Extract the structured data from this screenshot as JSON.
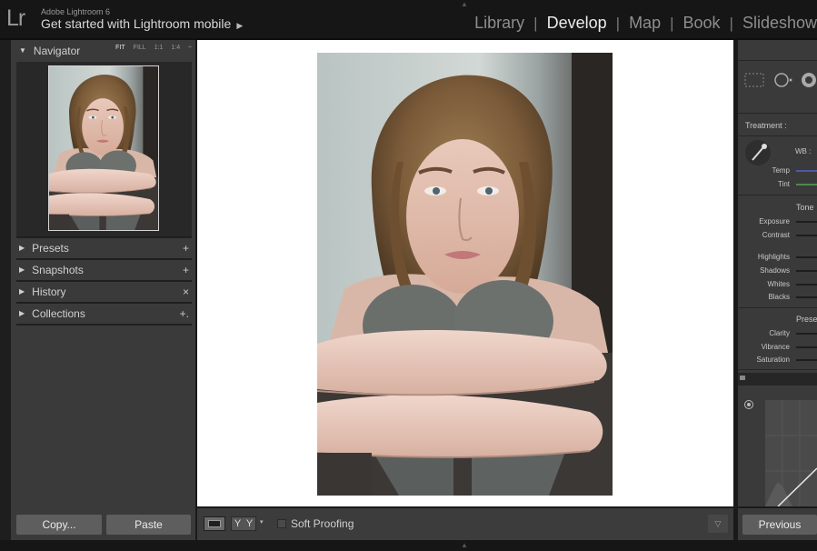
{
  "app": {
    "logo": "Lr",
    "version": "Adobe Lightroom 6",
    "mobile_prompt": "Get started with Lightroom mobile",
    "mobile_arrow": "▶"
  },
  "modules": [
    "Library",
    "Develop",
    "Map",
    "Book",
    "Slideshow"
  ],
  "active_module": "Develop",
  "navigator": {
    "title": "Navigator",
    "zoom": [
      "FIT",
      "FILL",
      "1:1",
      "1:4",
      "÷"
    ],
    "active_zoom": "FIT"
  },
  "left_panels": [
    {
      "label": "Presets",
      "action": "+"
    },
    {
      "label": "Snapshots",
      "action": "+"
    },
    {
      "label": "History",
      "action": "×"
    },
    {
      "label": "Collections",
      "action": "+."
    }
  ],
  "left_buttons": {
    "copy": "Copy...",
    "paste": "Paste"
  },
  "toolbar": {
    "yy": [
      "Y",
      "Y"
    ],
    "caret": "▾",
    "soft_proofing": "Soft Proofing",
    "menu_caret": "▽"
  },
  "basic": {
    "treatment": "Treatment :",
    "wb": "WB :",
    "temp": "Temp",
    "tint": "Tint",
    "tone": "Tone",
    "exposure": "Exposure",
    "contrast": "Contrast",
    "highlights": "Highlights",
    "shadows": "Shadows",
    "whites": "Whites",
    "blacks": "Blacks",
    "presence": "Prese",
    "clarity": "Clarity",
    "vibrance": "Vibrance",
    "saturation": "Saturation"
  },
  "right_buttons": {
    "previous": "Previous"
  },
  "colors": {
    "accent": "#eaeaea",
    "panel": "#3a3a3a",
    "temp_slider": "#4a5aa8",
    "tint_slider": "#4c8a4c"
  }
}
